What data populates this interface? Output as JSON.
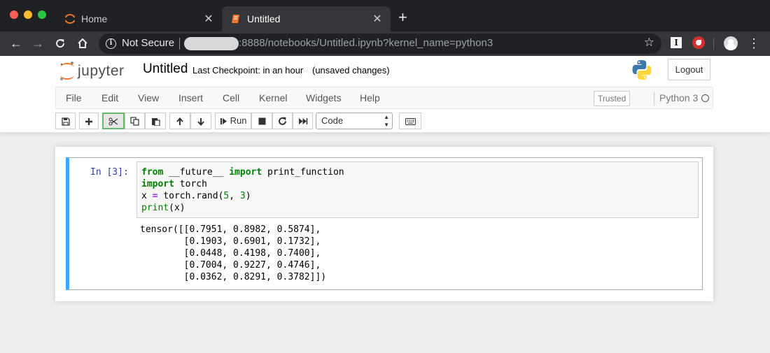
{
  "browser": {
    "tabs": [
      {
        "title": "Home",
        "active": false
      },
      {
        "title": "Untitled",
        "active": true
      }
    ],
    "security_label": "Not Secure",
    "url_visible": ":8888/notebooks/Untitled.ipynb?kernel_name=python3",
    "ext1_glyph": "I"
  },
  "header": {
    "logo_text": "jupyter",
    "notebook_title": "Untitled",
    "checkpoint": "Last Checkpoint: in an hour",
    "save_status": "(unsaved changes)",
    "logout_label": "Logout"
  },
  "menubar": {
    "items": [
      "File",
      "Edit",
      "View",
      "Insert",
      "Cell",
      "Kernel",
      "Widgets",
      "Help"
    ],
    "trusted_label": "Trusted",
    "kernel_name": "Python 3"
  },
  "toolbar": {
    "run_label": "Run",
    "cell_type": "Code",
    "icons": [
      "save-icon",
      "plus-icon",
      "cut-icon",
      "copy-icon",
      "paste-icon",
      "arrow-up-icon",
      "arrow-down-icon",
      "step-forward-icon",
      "stop-icon",
      "refresh-icon",
      "fast-forward-icon",
      "keyboard-icon"
    ]
  },
  "cell": {
    "prompt": "In [3]:",
    "code_tokens": {
      "l1": {
        "kw1": "from",
        "mod": " __future__ ",
        "kw2": "import",
        "rest": " print_function"
      },
      "l2": {
        "kw": "import",
        "rest": " torch"
      },
      "l3": {
        "a": "x ",
        "op": "=",
        "b": " torch.rand(",
        "n1": "5",
        "c": ", ",
        "n2": "3",
        "d": ")"
      },
      "l4": {
        "fn": "print",
        "rest": "(x)"
      }
    },
    "output_lines": [
      "tensor([[0.7951, 0.8982, 0.5874],",
      "        [0.1903, 0.6901, 0.1732],",
      "        [0.0448, 0.4198, 0.7400],",
      "        [0.7004, 0.9227, 0.4746],",
      "        [0.0362, 0.8291, 0.3782]])"
    ]
  },
  "colors": {
    "accent_cell_border": "#42a5f5",
    "prompt": "#303f9f",
    "keyword": "#008000"
  }
}
